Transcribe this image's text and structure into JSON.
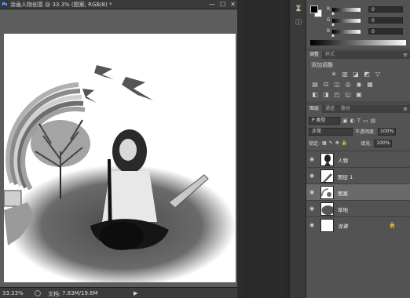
{
  "document": {
    "app_icon": "Ps",
    "title": "涂画人物创意 @ 33.3% (图案, RGB/8) *",
    "controls": [
      "—",
      "☐",
      "✕"
    ]
  },
  "status": {
    "zoom": "33.33%",
    "doc_label": "文档:",
    "doc_size": "7.83M/19.6M",
    "arrow": "▶"
  },
  "dock": {
    "icons": [
      "history-icon",
      "info-icon"
    ]
  },
  "color_panel": {
    "channels": [
      {
        "label": "R",
        "value": "0"
      },
      {
        "label": "G",
        "value": "0"
      },
      {
        "label": "B",
        "value": "0"
      }
    ],
    "foreground": "#000000",
    "background": "#ffffff"
  },
  "adjustments_panel": {
    "tabs": [
      "调整",
      "样式"
    ],
    "title": "添加调整",
    "row1": [
      "☀",
      "▥",
      "◪",
      "◩",
      "▽"
    ],
    "row2": [
      "▤",
      "⚖",
      "◫",
      "◎",
      "◉",
      "▦"
    ],
    "row3": [
      "◧",
      "◨",
      "◰",
      "◱",
      "▣"
    ]
  },
  "layers_panel": {
    "tabs": [
      "图层",
      "通道",
      "路径"
    ],
    "filter_kind": "P 类型",
    "blend_mode": "正常",
    "opacity_label": "不透明度:",
    "opacity_value": "100%",
    "lock_label": "锁定:",
    "fill_label": "填充:",
    "fill_value": "100%",
    "layers": [
      {
        "name": "人物",
        "selected": false,
        "italic": false,
        "locked": false
      },
      {
        "name": "图层 1",
        "selected": false,
        "italic": false,
        "locked": false
      },
      {
        "name": "图案",
        "selected": true,
        "italic": false,
        "locked": false
      },
      {
        "name": "草地",
        "selected": false,
        "italic": false,
        "locked": false
      },
      {
        "name": "背景",
        "selected": false,
        "italic": true,
        "locked": true
      }
    ]
  }
}
